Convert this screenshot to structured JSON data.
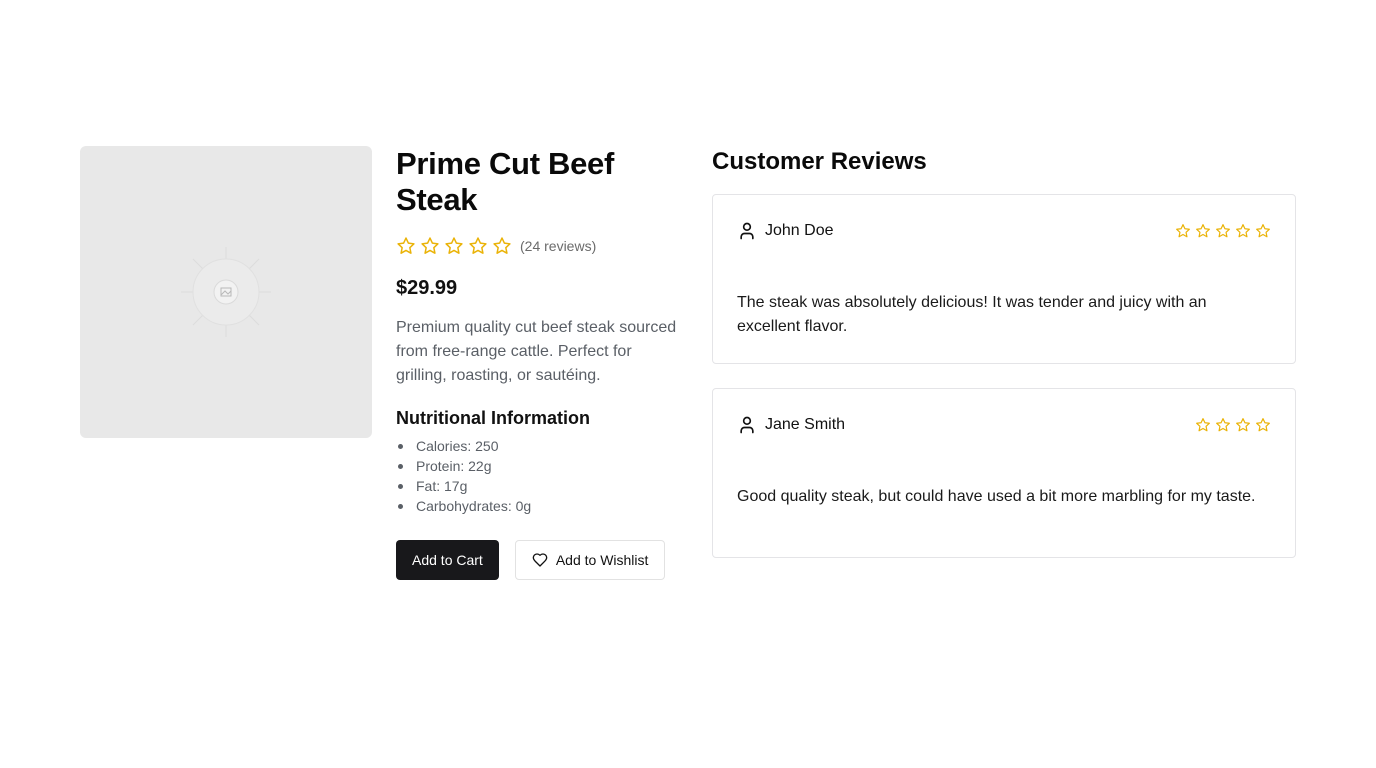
{
  "product": {
    "title": "Prime Cut Beef Steak",
    "image_icon": "image-placeholder-icon",
    "rating_stars": 5,
    "review_count_text": "(24 reviews)",
    "price": "$29.99",
    "description": "Premium quality cut beef steak sourced from free-range cattle. Perfect for grilling, roasting, or sautéing.",
    "nutrition_title": "Nutritional Information",
    "nutrition": [
      "Calories: 250",
      "Protein: 22g",
      "Fat: 17g",
      "Carbohydrates: 0g"
    ],
    "add_to_cart_label": "Add to Cart",
    "add_to_wishlist_label": "Add to Wishlist"
  },
  "reviews": {
    "title": "Customer Reviews",
    "items": [
      {
        "name": "John Doe",
        "stars": 5,
        "text": "The steak was absolutely delicious! It was tender and juicy with an excellent flavor."
      },
      {
        "name": "Jane Smith",
        "stars": 4,
        "text": "Good quality steak, but could have used a bit more marbling for my taste."
      }
    ]
  },
  "colors": {
    "star": "#eab308",
    "primary_button": "#18181b",
    "image_placeholder": "#e8e8e8"
  }
}
